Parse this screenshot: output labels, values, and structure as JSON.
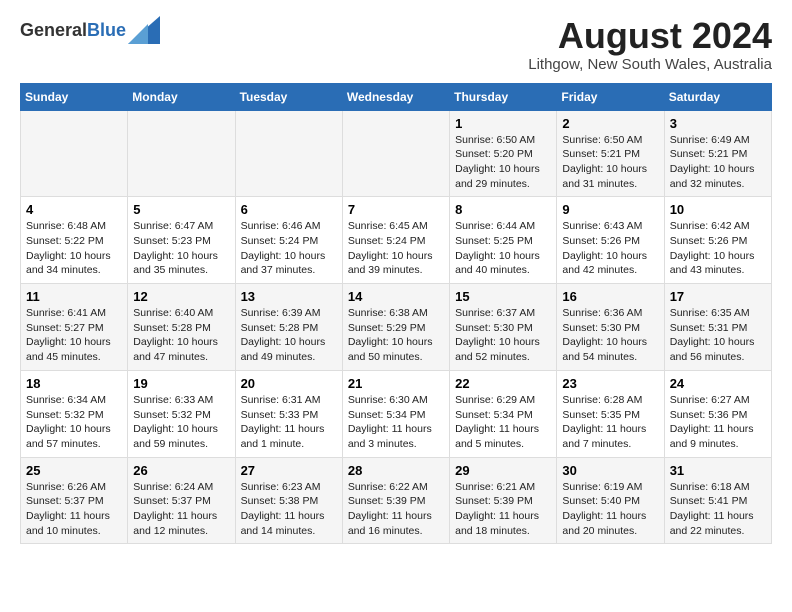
{
  "header": {
    "logo_general": "General",
    "logo_blue": "Blue",
    "title": "August 2024",
    "subtitle": "Lithgow, New South Wales, Australia"
  },
  "days_of_week": [
    "Sunday",
    "Monday",
    "Tuesday",
    "Wednesday",
    "Thursday",
    "Friday",
    "Saturday"
  ],
  "weeks": [
    {
      "cells": [
        {
          "day": "",
          "content": ""
        },
        {
          "day": "",
          "content": ""
        },
        {
          "day": "",
          "content": ""
        },
        {
          "day": "",
          "content": ""
        },
        {
          "day": "1",
          "content": "Sunrise: 6:50 AM\nSunset: 5:20 PM\nDaylight: 10 hours\nand 29 minutes."
        },
        {
          "day": "2",
          "content": "Sunrise: 6:50 AM\nSunset: 5:21 PM\nDaylight: 10 hours\nand 31 minutes."
        },
        {
          "day": "3",
          "content": "Sunrise: 6:49 AM\nSunset: 5:21 PM\nDaylight: 10 hours\nand 32 minutes."
        }
      ]
    },
    {
      "cells": [
        {
          "day": "4",
          "content": "Sunrise: 6:48 AM\nSunset: 5:22 PM\nDaylight: 10 hours\nand 34 minutes."
        },
        {
          "day": "5",
          "content": "Sunrise: 6:47 AM\nSunset: 5:23 PM\nDaylight: 10 hours\nand 35 minutes."
        },
        {
          "day": "6",
          "content": "Sunrise: 6:46 AM\nSunset: 5:24 PM\nDaylight: 10 hours\nand 37 minutes."
        },
        {
          "day": "7",
          "content": "Sunrise: 6:45 AM\nSunset: 5:24 PM\nDaylight: 10 hours\nand 39 minutes."
        },
        {
          "day": "8",
          "content": "Sunrise: 6:44 AM\nSunset: 5:25 PM\nDaylight: 10 hours\nand 40 minutes."
        },
        {
          "day": "9",
          "content": "Sunrise: 6:43 AM\nSunset: 5:26 PM\nDaylight: 10 hours\nand 42 minutes."
        },
        {
          "day": "10",
          "content": "Sunrise: 6:42 AM\nSunset: 5:26 PM\nDaylight: 10 hours\nand 43 minutes."
        }
      ]
    },
    {
      "cells": [
        {
          "day": "11",
          "content": "Sunrise: 6:41 AM\nSunset: 5:27 PM\nDaylight: 10 hours\nand 45 minutes."
        },
        {
          "day": "12",
          "content": "Sunrise: 6:40 AM\nSunset: 5:28 PM\nDaylight: 10 hours\nand 47 minutes."
        },
        {
          "day": "13",
          "content": "Sunrise: 6:39 AM\nSunset: 5:28 PM\nDaylight: 10 hours\nand 49 minutes."
        },
        {
          "day": "14",
          "content": "Sunrise: 6:38 AM\nSunset: 5:29 PM\nDaylight: 10 hours\nand 50 minutes."
        },
        {
          "day": "15",
          "content": "Sunrise: 6:37 AM\nSunset: 5:30 PM\nDaylight: 10 hours\nand 52 minutes."
        },
        {
          "day": "16",
          "content": "Sunrise: 6:36 AM\nSunset: 5:30 PM\nDaylight: 10 hours\nand 54 minutes."
        },
        {
          "day": "17",
          "content": "Sunrise: 6:35 AM\nSunset: 5:31 PM\nDaylight: 10 hours\nand 56 minutes."
        }
      ]
    },
    {
      "cells": [
        {
          "day": "18",
          "content": "Sunrise: 6:34 AM\nSunset: 5:32 PM\nDaylight: 10 hours\nand 57 minutes."
        },
        {
          "day": "19",
          "content": "Sunrise: 6:33 AM\nSunset: 5:32 PM\nDaylight: 10 hours\nand 59 minutes."
        },
        {
          "day": "20",
          "content": "Sunrise: 6:31 AM\nSunset: 5:33 PM\nDaylight: 11 hours\nand 1 minute."
        },
        {
          "day": "21",
          "content": "Sunrise: 6:30 AM\nSunset: 5:34 PM\nDaylight: 11 hours\nand 3 minutes."
        },
        {
          "day": "22",
          "content": "Sunrise: 6:29 AM\nSunset: 5:34 PM\nDaylight: 11 hours\nand 5 minutes."
        },
        {
          "day": "23",
          "content": "Sunrise: 6:28 AM\nSunset: 5:35 PM\nDaylight: 11 hours\nand 7 minutes."
        },
        {
          "day": "24",
          "content": "Sunrise: 6:27 AM\nSunset: 5:36 PM\nDaylight: 11 hours\nand 9 minutes."
        }
      ]
    },
    {
      "cells": [
        {
          "day": "25",
          "content": "Sunrise: 6:26 AM\nSunset: 5:37 PM\nDaylight: 11 hours\nand 10 minutes."
        },
        {
          "day": "26",
          "content": "Sunrise: 6:24 AM\nSunset: 5:37 PM\nDaylight: 11 hours\nand 12 minutes."
        },
        {
          "day": "27",
          "content": "Sunrise: 6:23 AM\nSunset: 5:38 PM\nDaylight: 11 hours\nand 14 minutes."
        },
        {
          "day": "28",
          "content": "Sunrise: 6:22 AM\nSunset: 5:39 PM\nDaylight: 11 hours\nand 16 minutes."
        },
        {
          "day": "29",
          "content": "Sunrise: 6:21 AM\nSunset: 5:39 PM\nDaylight: 11 hours\nand 18 minutes."
        },
        {
          "day": "30",
          "content": "Sunrise: 6:19 AM\nSunset: 5:40 PM\nDaylight: 11 hours\nand 20 minutes."
        },
        {
          "day": "31",
          "content": "Sunrise: 6:18 AM\nSunset: 5:41 PM\nDaylight: 11 hours\nand 22 minutes."
        }
      ]
    }
  ]
}
